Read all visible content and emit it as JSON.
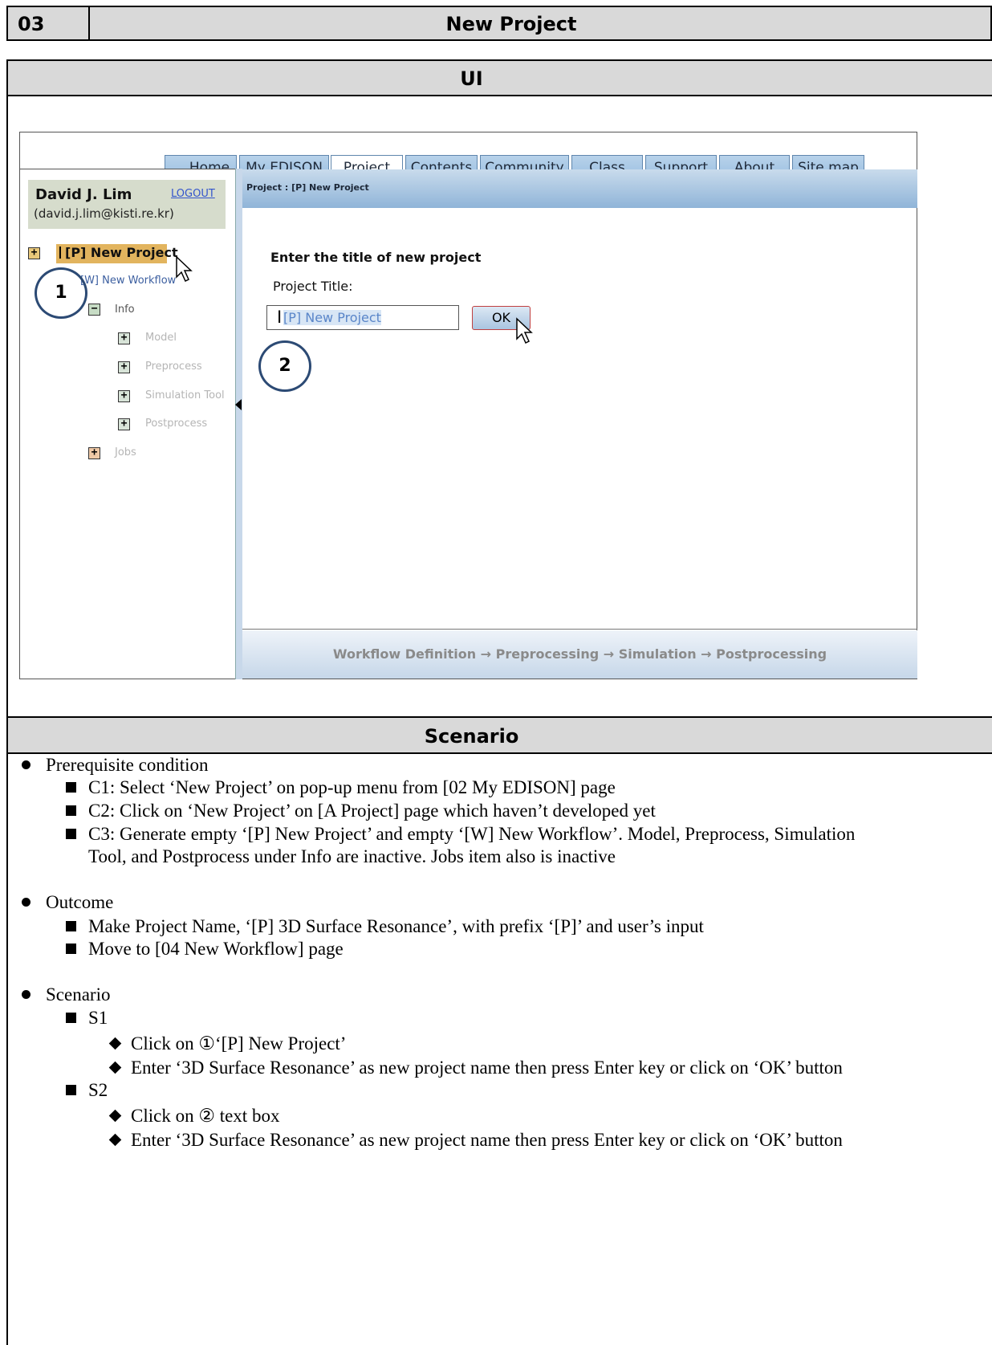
{
  "doc": {
    "number": "03",
    "title": "New Project",
    "ui_section": "UI",
    "scenario_section": "Scenario"
  },
  "nav": {
    "tabs": [
      "Home",
      "My EDISON",
      "Project",
      "Contents",
      "Community",
      "Class",
      "Support",
      "About",
      "Site map"
    ],
    "active": "Project"
  },
  "user": {
    "name": "David J. Lim",
    "email": "(david.j.lim@kisti.re.kr)",
    "logout": "LOGOUT"
  },
  "tree": {
    "project": "[P] New Project",
    "workflow": "[W] New Workflow",
    "info": "Info",
    "model": "Model",
    "preprocess": "Preprocess",
    "simulation_tool": "Simulation Tool",
    "postprocess": "Postprocess",
    "jobs": "Jobs"
  },
  "breadcrumb": "Project : [P] New Project",
  "form": {
    "heading": "Enter the title of new project",
    "label": "Project Title:",
    "value": "[P] New Project",
    "ok": "OK"
  },
  "footer_flow": "Workflow Definition → Preprocessing → Simulation → Postprocessing",
  "callouts": [
    "1",
    "2"
  ],
  "scenario": {
    "prereq_title": "Prerequisite condition",
    "c1": "C1: Select ‘New Project’ on pop-up menu from [02 My EDISON] page",
    "c2": "C2: Click on ‘New Project’ on [A Project] page which haven’t developed yet",
    "c3a": "C3: Generate empty ‘[P] New Project’ and empty ‘[W] New Workflow’. Model, Preprocess, Simulation",
    "c3b": "Tool, and Postprocess under Info are inactive. Jobs item also is inactive",
    "outcome_title": "Outcome",
    "o1": "Make Project Name, ‘[P] 3D Surface Resonance’, with prefix ‘[P]’ and user’s input",
    "o2": "Move to [04 New Workflow] page",
    "scenario_title": "Scenario",
    "s1": "S1",
    "s1a": "Click on  ①‘[P] New Project’",
    "s1b": "Enter ‘3D Surface Resonance’ as new project name then press Enter key or click on ‘OK’ button",
    "s2": "S2",
    "s2a": "Click on  ②  text box",
    "s2b": "Enter ‘3D Surface Resonance’ as new project name then press Enter key or click on ‘OK’ button"
  }
}
